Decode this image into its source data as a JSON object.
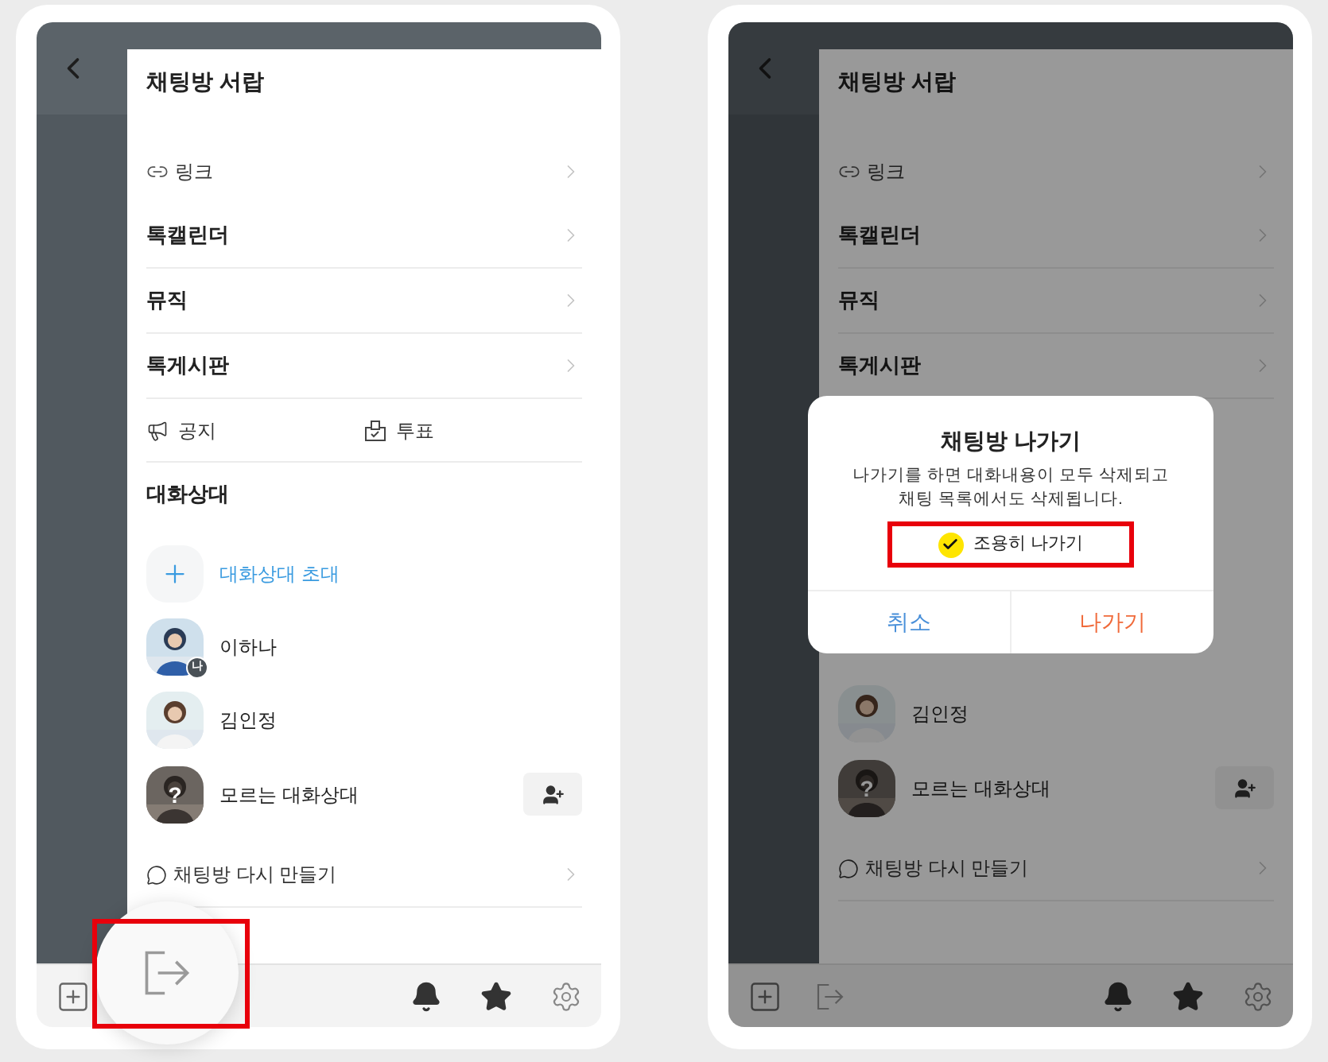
{
  "screens": [
    {
      "dimmed": false,
      "rows_above": [
        {
          "kind": "header",
          "label": "채팅방 서랍"
        },
        {
          "kind": "spacer"
        },
        {
          "kind": "link",
          "label": "링크"
        },
        {
          "kind": "menu",
          "label": "톡캘린더"
        },
        {
          "kind": "menu",
          "label": "뮤직"
        },
        {
          "kind": "menu",
          "label": "톡게시판"
        },
        {
          "kind": "pair",
          "items": [
            {
              "kind": "notice",
              "label": "공지"
            },
            {
              "kind": "vote",
              "label": "투표"
            }
          ]
        },
        {
          "kind": "section",
          "label": "대화상대"
        },
        {
          "kind": "invite",
          "label": "대화상대 초대"
        },
        {
          "kind": "member",
          "label": "이하나",
          "badge": "나"
        },
        {
          "kind": "member",
          "label": "김인정"
        },
        {
          "kind": "unknown",
          "label": "모르는 대화상대",
          "mark": "?"
        },
        {
          "kind": "recreate",
          "label": "채팅방 다시 만들기"
        }
      ],
      "bottom_bar": {
        "exit_highlighted": true
      }
    },
    {
      "dimmed": true,
      "rows_above": [
        {
          "kind": "header",
          "label": "채팅방 서랍"
        },
        {
          "kind": "spacer"
        },
        {
          "kind": "link",
          "label": "링크"
        },
        {
          "kind": "menu",
          "label": "톡캘린더"
        },
        {
          "kind": "menu",
          "label": "뮤직"
        },
        {
          "kind": "menu",
          "label": "톡게시판"
        }
      ],
      "dialog": {
        "title": "채팅방 나가기",
        "message": "나가기를 하면 대화내용이 모두 삭제되고\n채팅 목록에서도 삭제됩니다.",
        "option": {
          "label": "조용히 나가기",
          "checked": true,
          "highlighted": true
        },
        "buttons": [
          {
            "kind": "cancel",
            "label": "취소"
          },
          {
            "kind": "confirm",
            "label": "나가기"
          }
        ]
      },
      "rows_below": [
        {
          "kind": "member",
          "label": "김인정"
        },
        {
          "kind": "unknown",
          "label": "모르는 대화상대",
          "mark": "?"
        },
        {
          "kind": "recreate",
          "label": "채팅방 다시 만들기"
        }
      ],
      "bottom_bar": {
        "exit_highlighted": false
      }
    }
  ]
}
